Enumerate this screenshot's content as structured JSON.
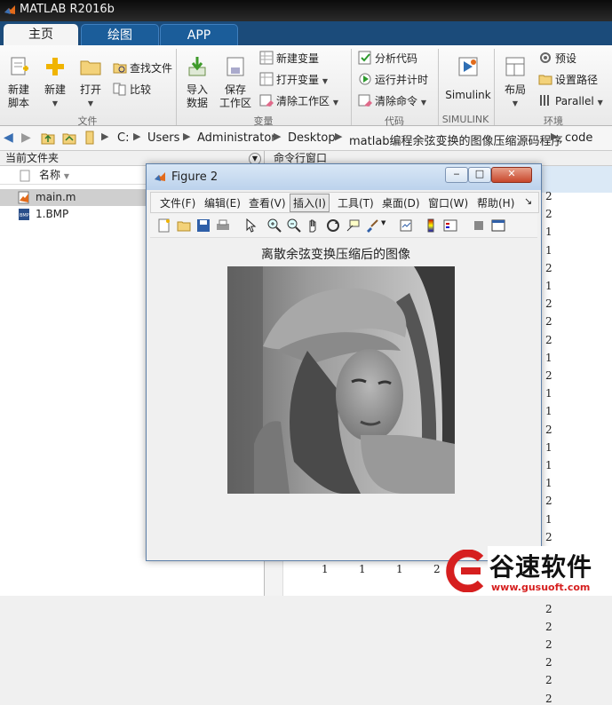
{
  "app": {
    "title": "MATLAB R2016b"
  },
  "tabs": [
    {
      "label": "主页",
      "active": true
    },
    {
      "label": "绘图",
      "active": false
    },
    {
      "label": "APP",
      "active": false
    }
  ],
  "ribbon": {
    "file": {
      "new_script": [
        "新建",
        "脚本"
      ],
      "new": "新建",
      "open": "打开",
      "find_files": "查找文件",
      "compare": "比较",
      "section": "文件"
    },
    "variable": {
      "import": [
        "导入",
        "数据"
      ],
      "save_ws": [
        "保存",
        "工作区"
      ],
      "new_var": "新建变量",
      "open_var": "打开变量",
      "clear_ws": "清除工作区",
      "section": "变量"
    },
    "code": {
      "analyze": "分析代码",
      "run_time": "运行并计时",
      "clear_cmd": "清除命令",
      "section": "代码"
    },
    "simulink": {
      "label": "Simulink",
      "section": "SIMULINK"
    },
    "env": {
      "layout": "布局",
      "prefs": "预设",
      "set_path": "设置路径",
      "parallel": "Parallel",
      "section": "环境"
    }
  },
  "address": {
    "path": [
      "C:",
      "Users",
      "Administrator",
      "Desktop",
      "matlab编程余弦变换的图像压缩源码程序",
      "code"
    ]
  },
  "current_folder": {
    "title": "当前文件夹",
    "name_col": "名称",
    "files": [
      "main.m",
      "1.BMP"
    ]
  },
  "command_window": {
    "title": "命令行窗口",
    "right_column": [
      "2",
      "2",
      "1",
      "1",
      "2",
      "1",
      "2",
      "2",
      "2",
      "1",
      "2",
      "1",
      "1",
      "2",
      "1",
      "1",
      "1",
      "2",
      "1",
      "2",
      "1",
      "2",
      "1",
      "2",
      "2",
      "2",
      "2",
      "2",
      "2"
    ],
    "bottom_row": [
      "1",
      "1",
      "1",
      "2"
    ]
  },
  "figure": {
    "title": "Figure 2",
    "menu": [
      "文件(F)",
      "编辑(E)",
      "查看(V)",
      "插入(I)",
      "工具(T)",
      "桌面(D)",
      "窗口(W)",
      "帮助(H)"
    ],
    "plot_title": "离散余弦变换压缩后的图像"
  },
  "watermark": {
    "brand": "谷速软件",
    "url": "www.gusuoft.com"
  },
  "colors": {
    "tabbar": "#1b4b7a",
    "brand_red": "#d61f1f"
  }
}
